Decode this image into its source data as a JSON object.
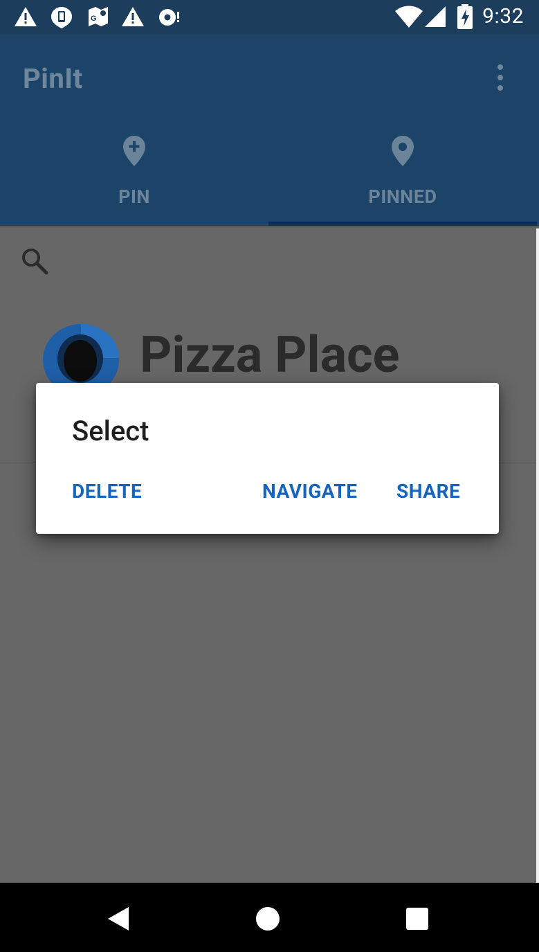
{
  "status_bar": {
    "time": "9:32",
    "left_icons": [
      "warning-icon",
      "phone-notification-icon",
      "maps-icon",
      "warning-icon",
      "sync-icon"
    ],
    "right_icons": [
      "wifi-icon",
      "cellular-signal-icon",
      "battery-charging-icon"
    ]
  },
  "app_bar": {
    "title": "PinIt",
    "overflow_icon": "more-vert-icon"
  },
  "tabs": [
    {
      "label": "PIN",
      "icon": "add-location-icon",
      "selected": false
    },
    {
      "label": "PINNED",
      "icon": "location-pin-icon",
      "selected": true
    }
  ],
  "content": {
    "search_icon": "search-icon",
    "items": [
      {
        "name": "Pizza Place",
        "icon": "pin-logo-icon"
      }
    ]
  },
  "dialog": {
    "title": "Select",
    "buttons": {
      "delete": "DELETE",
      "navigate": "NAVIGATE",
      "share": "SHARE"
    }
  },
  "nav_bar": {
    "buttons": [
      "back-icon",
      "home-icon",
      "recents-icon"
    ]
  },
  "colors": {
    "status_bar": "#1c3d5c",
    "app_bar": "#1c4468",
    "tab_indicator": "#0b2f55",
    "scrim_background": "#676767",
    "dialog_button": "#1565c0",
    "pin_blue": "#1f5fa8"
  }
}
